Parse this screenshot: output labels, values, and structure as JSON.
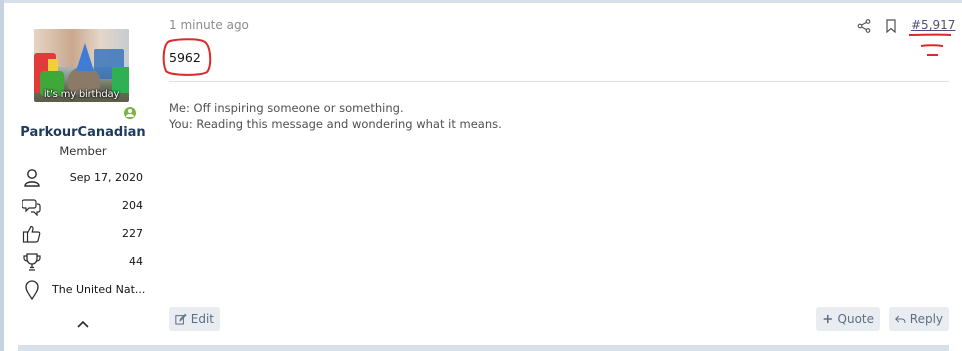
{
  "user": {
    "avatar_caption": "it's my birthday",
    "username": "ParkourCanadian",
    "title": "Member",
    "stats": [
      {
        "icon": "user-icon",
        "value": "Sep 17, 2020"
      },
      {
        "icon": "messages-icon",
        "value": "204"
      },
      {
        "icon": "thumbs-up-icon",
        "value": "227"
      },
      {
        "icon": "trophy-icon",
        "value": "44"
      },
      {
        "icon": "location-icon",
        "value": "The United Nat..."
      }
    ]
  },
  "post": {
    "time": "1 minute ago",
    "number": "#5,917",
    "body": "5962",
    "signature_line1": "Me: Off inspiring someone or something.",
    "signature_line2": "You: Reading this message and wondering what it means."
  },
  "actions": {
    "edit": "Edit",
    "quote": "Quote",
    "reply": "Reply"
  },
  "colors": {
    "accent": "#1f3a5a",
    "annotation": "#d92b2b",
    "online": "#7cb342",
    "button_bg": "#e9edf2"
  }
}
